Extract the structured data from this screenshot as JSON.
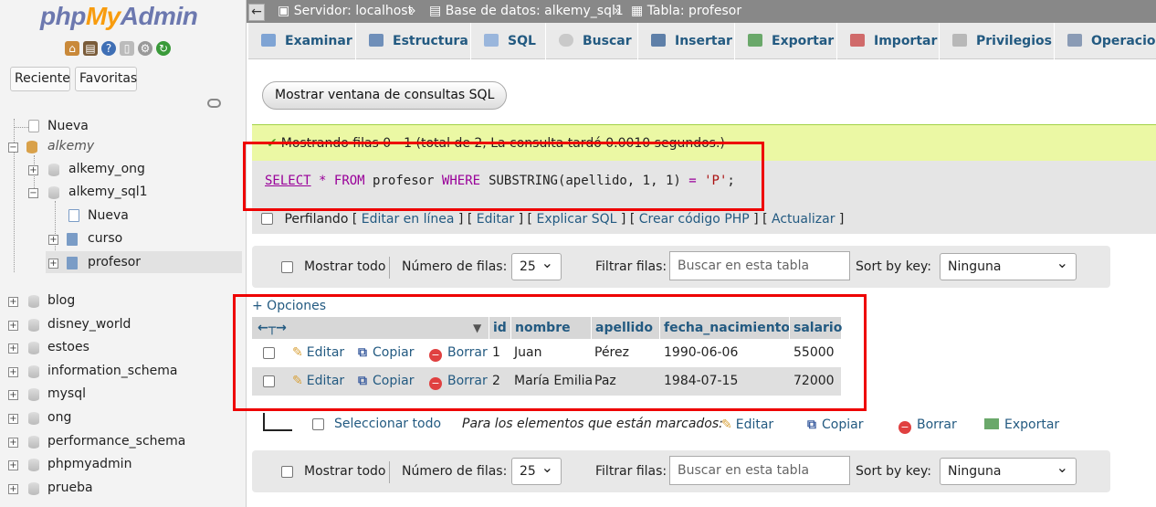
{
  "app": {
    "logo_a": "php",
    "logo_b": "My",
    "logo_c": "Admin"
  },
  "nav": {
    "recent_tab": "Reciente",
    "favorites_tab": "Favoritas",
    "new_top": "Nueva",
    "group": "alkemy",
    "db_alkemy_ong": "alkemy_ong",
    "db_alkemy_sql1": "alkemy_sql1",
    "new_table": "Nueva",
    "table_curso": "curso",
    "table_profesor": "profesor",
    "databases": [
      "blog",
      "disney_world",
      "estoes",
      "information_schema",
      "mysql",
      "ong",
      "performance_schema",
      "phpmyadmin",
      "prueba"
    ]
  },
  "breadcrumb": {
    "server": "Servidor: localhost",
    "sep": "»",
    "database": "Base de datos: alkemy_sql1",
    "table": "Tabla: profesor"
  },
  "tabs": [
    "Examinar",
    "Estructura",
    "SQL",
    "Buscar",
    "Insertar",
    "Exportar",
    "Importar",
    "Privilegios",
    "Operacion"
  ],
  "sql_window_button": "Mostrar ventana de consultas SQL",
  "message": "Mostrando filas 0 - 1 (total de 2, La consulta tardó 0.0010 segundos.)",
  "query": {
    "select": "SELECT",
    "star": "*",
    "from": "FROM",
    "table": "profesor",
    "where": "WHERE",
    "func": "SUBSTRING",
    "args": "(apellido, 1, 1)",
    "eq": "=",
    "value": "'P'",
    "end": ";"
  },
  "profiling": {
    "label": "Perfilando",
    "links": [
      "Editar en línea",
      "Editar",
      "Explicar SQL",
      "Crear código PHP",
      "Actualizar"
    ]
  },
  "navbar": {
    "show_all": "Mostrar todo",
    "rows_label": "Número de filas:",
    "rows_value": "25",
    "filter_label": "Filtrar filas:",
    "filter_placeholder": "Buscar en esta tabla",
    "sort_label": "Sort by key:",
    "sort_value": "Ninguna"
  },
  "options_link": "+ Opciones",
  "columns": [
    "id",
    "nombre",
    "apellido",
    "fecha_nacimiento",
    "salario"
  ],
  "row_actions": {
    "edit": "Editar",
    "copy": "Copiar",
    "delete": "Borrar"
  },
  "rows": [
    {
      "id": "1",
      "nombre": "Juan",
      "apellido": "Pérez",
      "fecha_nacimiento": "1990-06-06",
      "salario": "55000"
    },
    {
      "id": "2",
      "nombre": "María Emilia",
      "apellido": "Paz",
      "fecha_nacimiento": "1984-07-15",
      "salario": "72000"
    }
  ],
  "bulk": {
    "select_all": "Seleccionar todo",
    "marked_label": "Para los elementos que están marcados:",
    "edit": "Editar",
    "copy": "Copiar",
    "delete": "Borrar",
    "export": "Exportar"
  },
  "colors": {
    "link": "#235a81",
    "success_bg": "#ebf8a4",
    "highlight_red": "#ee0000",
    "logo_blue": "#6c78af",
    "logo_orange": "#f89c0e"
  }
}
